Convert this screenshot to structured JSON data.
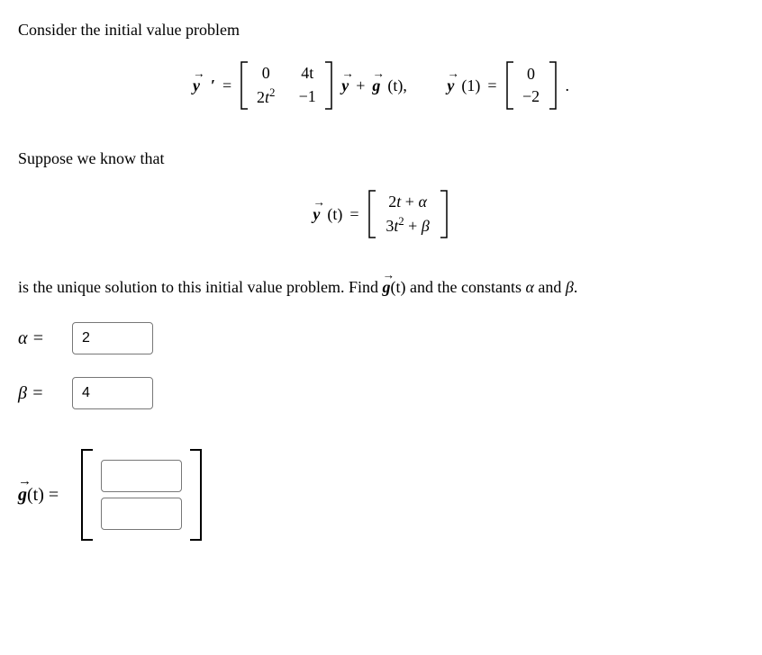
{
  "problem": {
    "intro": "Consider the initial value problem",
    "suppose": "Suppose we know that",
    "conclusion_part1": "is the unique solution to this initial value problem. Find ",
    "conclusion_part2": " and the constants ",
    "conclusion_part3": " and ",
    "conclusion_part4": "."
  },
  "equations": {
    "yprime_label": "y",
    "prime": "′",
    "equals": "=",
    "matrix_A": {
      "r1c1": "0",
      "r1c2": "4t",
      "r2c1": "2t²",
      "r2c2": "−1"
    },
    "y_label": "y",
    "plus": "+",
    "g_label": "g",
    "of_t": "(t),",
    "y1_text": "y",
    "y1_arg": "(1)",
    "y1_vec": {
      "r1": "0",
      "r2": "−2"
    },
    "period": ".",
    "yt": "y",
    "yt_arg": "(t)",
    "sol_vec": {
      "r1": "2t + α",
      "r2": "3t² + β"
    }
  },
  "answers": {
    "alpha_label": "α =",
    "alpha_value": "2",
    "beta_label": "β =",
    "beta_value": "4",
    "g_label_text": "g",
    "g_arg": "(t) =",
    "g_r1": "",
    "g_r2": ""
  },
  "symbols": {
    "alpha": "α",
    "beta": "β",
    "g_of_t": "g",
    "g_of_t_arg": "(t)"
  }
}
